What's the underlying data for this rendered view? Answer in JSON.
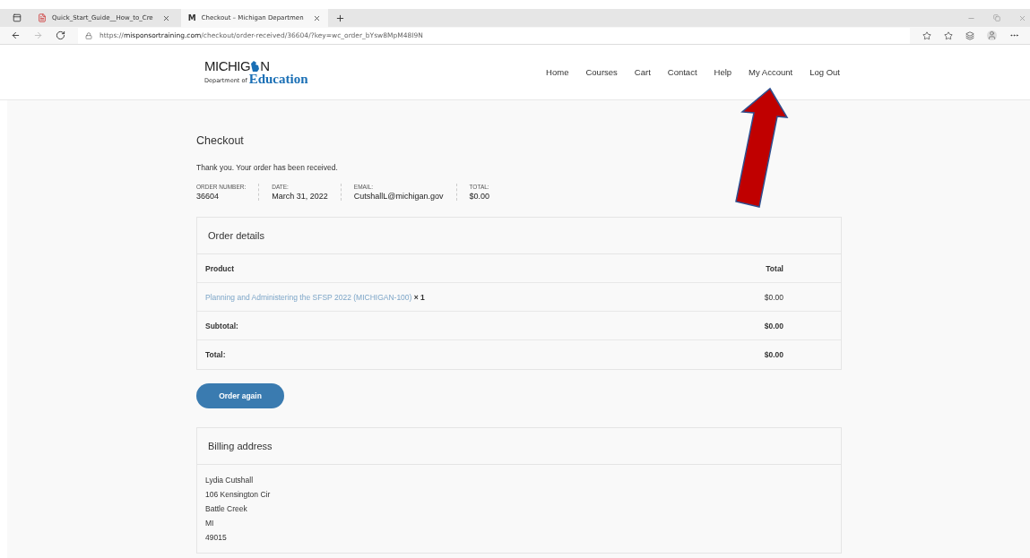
{
  "browser": {
    "tabs": [
      {
        "label": "Quick_Start_Guide__How_to_Cre",
        "kind": "file",
        "selected": false
      },
      {
        "label": "Checkout – Michigan Departmen",
        "kind": "site",
        "favicon": "M",
        "selected": true
      }
    ],
    "url_prefix": "https://",
    "url_domain": "misponsortraining.com",
    "url_path": "/checkout/order-received/36604/?key=wc_order_bYsw8MpM48I9N"
  },
  "logo": {
    "left": "MICHIG",
    "right": "N",
    "small": "Department of",
    "main": "Education"
  },
  "nav": [
    "Home",
    "Courses",
    "Cart",
    "Contact",
    "Help",
    "My Account",
    "Log Out"
  ],
  "page_title": "Checkout",
  "notice": "Thank you. Your order has been received.",
  "overview": [
    {
      "label": "ORDER NUMBER:",
      "value": "36604"
    },
    {
      "label": "DATE:",
      "value": "March 31, 2022"
    },
    {
      "label": "EMAIL:",
      "value": "CutshallL@michigan.gov"
    },
    {
      "label": "TOTAL:",
      "value": "$0.00"
    }
  ],
  "order_details": {
    "title": "Order details",
    "columns": [
      "Product",
      "Total"
    ],
    "rows": [
      {
        "kind": "item",
        "product": "Planning and Administering the SFSP 2022 (MICHIGAN-100)",
        "qty": "× 1",
        "total": "$0.00"
      },
      {
        "kind": "summary",
        "product": "Subtotal:",
        "total": "$0.00"
      },
      {
        "kind": "summary",
        "product": "Total:",
        "total": "$0.00"
      }
    ]
  },
  "order_again": "Order again",
  "billing": {
    "title": "Billing address",
    "lines": [
      "Lydia Cutshall",
      "106 Kensington Cir",
      "Battle Creek",
      "MI",
      "49015"
    ]
  }
}
